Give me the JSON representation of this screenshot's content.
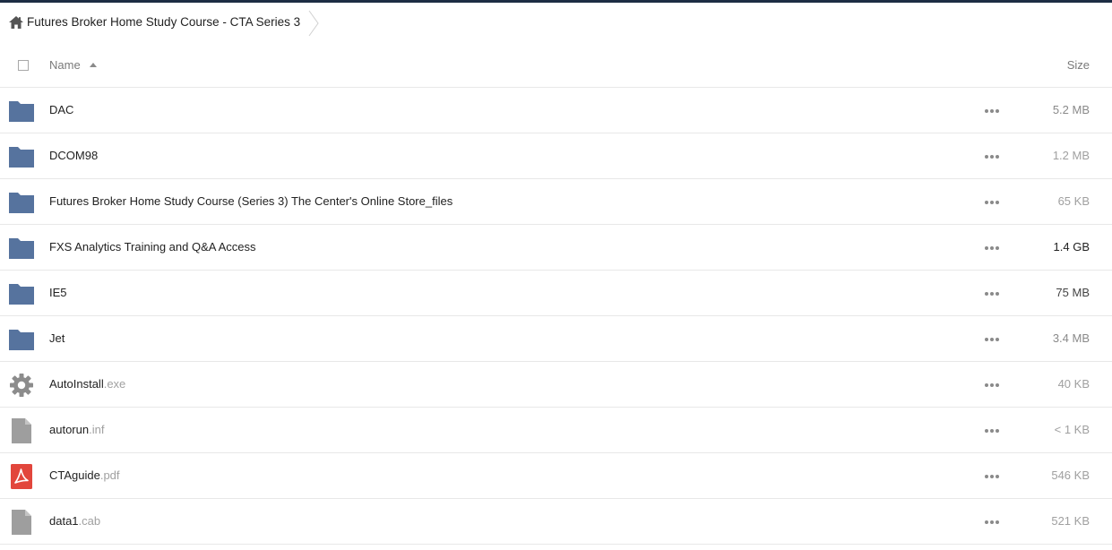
{
  "breadcrumb": {
    "home_icon": "home-icon",
    "title": "Futures Broker Home Study Course - CTA Series 3"
  },
  "header": {
    "name_label": "Name",
    "size_label": "Size",
    "sort": "ascending"
  },
  "colors": {
    "topbar": "#1d2d44",
    "folder": "#56739e",
    "generic_file": "#9e9e9e",
    "pdf": "#e2463c"
  },
  "files": [
    {
      "type": "folder",
      "icon": "folder-icon",
      "name": "DAC",
      "ext": "",
      "size": "5.2 MB",
      "size_color": "#8a8a8a"
    },
    {
      "type": "folder",
      "icon": "folder-icon",
      "name": "DCOM98",
      "ext": "",
      "size": "1.2 MB",
      "size_color": "#a0a0a0"
    },
    {
      "type": "folder",
      "icon": "folder-icon",
      "name": "Futures Broker Home Study Course (Series 3) The Center's Online Store_files",
      "ext": "",
      "size": "65 KB",
      "size_color": "#a0a0a0"
    },
    {
      "type": "folder",
      "icon": "folder-icon",
      "name": "FXS Analytics Training and Q&A Access",
      "ext": "",
      "size": "1.4 GB",
      "size_color": "#222222"
    },
    {
      "type": "folder",
      "icon": "folder-icon",
      "name": "IE5",
      "ext": "",
      "size": "75 MB",
      "size_color": "#444444"
    },
    {
      "type": "folder",
      "icon": "folder-icon",
      "name": "Jet",
      "ext": "",
      "size": "3.4 MB",
      "size_color": "#8a8a8a"
    },
    {
      "type": "exe",
      "icon": "gear-icon",
      "name": "AutoInstall",
      "ext": ".exe",
      "size": "40 KB",
      "size_color": "#a0a0a0"
    },
    {
      "type": "file",
      "icon": "file-icon",
      "name": "autorun",
      "ext": ".inf",
      "size": "< 1 KB",
      "size_color": "#a0a0a0"
    },
    {
      "type": "pdf",
      "icon": "pdf-icon",
      "name": "CTAguide",
      "ext": ".pdf",
      "size": "546 KB",
      "size_color": "#a0a0a0"
    },
    {
      "type": "file",
      "icon": "file-icon",
      "name": "data1",
      "ext": ".cab",
      "size": "521 KB",
      "size_color": "#a0a0a0"
    }
  ]
}
